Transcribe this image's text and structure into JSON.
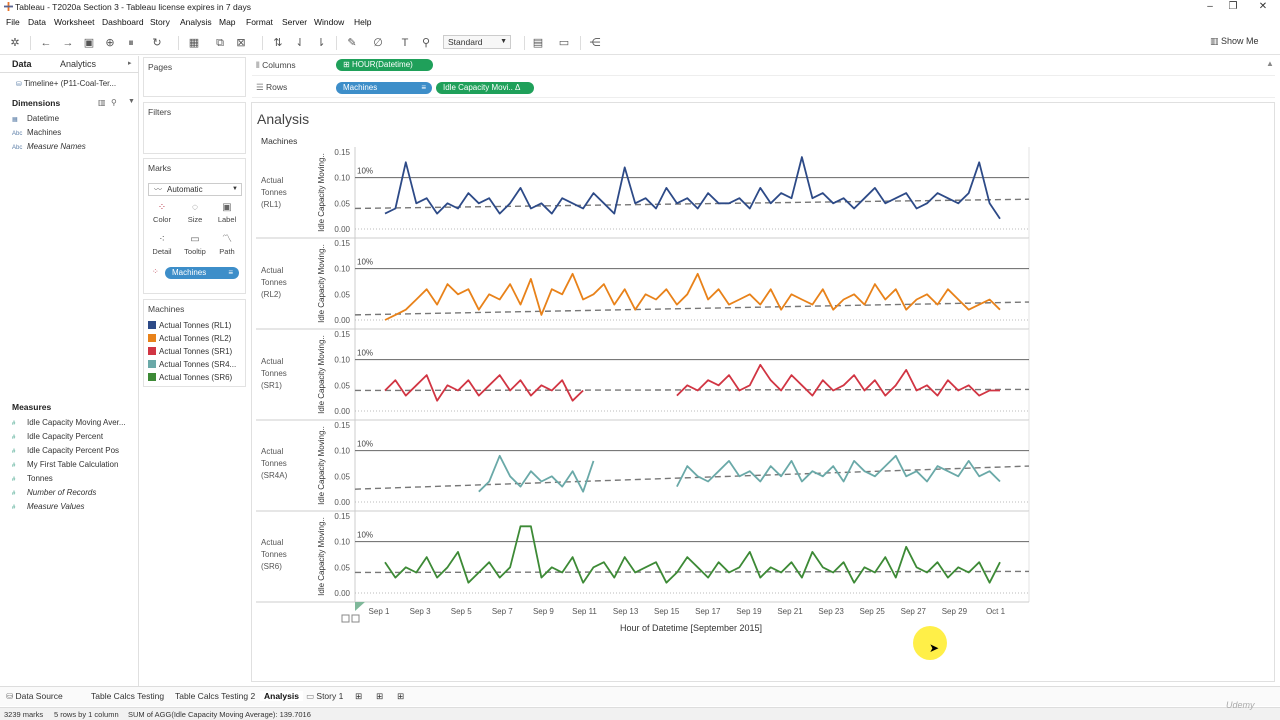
{
  "window": {
    "title": "Tableau - T2020a Section 3 - Tableau license expires in 7 days",
    "minimize": "–",
    "maximize": "❐",
    "close": "✕"
  },
  "menu": [
    "File",
    "Data",
    "Worksheet",
    "Dashboard",
    "Story",
    "Analysis",
    "Map",
    "Format",
    "Server",
    "Window",
    "Help"
  ],
  "toolbar": {
    "fit_select": "Standard",
    "show_me": "Show Me",
    "icons": [
      "tableau-logo-icon",
      "undo-icon",
      "redo-icon",
      "save-icon",
      "new-datasource-icon",
      "pause-icon",
      "refresh-icon",
      "new-worksheet-icon",
      "duplicate-icon",
      "clear-icon",
      "swap-icon",
      "sort-asc-icon",
      "sort-desc-icon",
      "highlight-icon",
      "group-icon",
      "label-icon",
      "pin-icon",
      "show-cards-icon",
      "presentation-icon",
      "share-icon"
    ]
  },
  "left_panel": {
    "tab_data": "Data",
    "tab_analytics": "Analytics",
    "datasource": "Timeline+ (P11-Coal-Ter...",
    "dimensions_title": "Dimensions",
    "dimensions": [
      {
        "icon": "date-icon",
        "label": "Datetime",
        "italic": false
      },
      {
        "icon": "abc-icon",
        "label": "Machines",
        "italic": false
      },
      {
        "icon": "abc-icon",
        "label": "Measure Names",
        "italic": true
      }
    ],
    "measures_title": "Measures",
    "measures": [
      {
        "label": "Idle Capacity Moving Aver...",
        "italic": false
      },
      {
        "label": "Idle Capacity Percent",
        "italic": false
      },
      {
        "label": "Idle Capacity Percent Pos",
        "italic": false
      },
      {
        "label": "My First Table Calculation",
        "italic": false
      },
      {
        "label": "Tonnes",
        "italic": false
      },
      {
        "label": "Number of Records",
        "italic": true
      },
      {
        "label": "Measure Values",
        "italic": true
      }
    ]
  },
  "cards": {
    "pages": "Pages",
    "filters": "Filters",
    "marks": "Marks",
    "marks_type": "Automatic",
    "mark_buttons": [
      {
        "label": "Color",
        "icon": "color-icon"
      },
      {
        "label": "Size",
        "icon": "size-icon"
      },
      {
        "label": "Label",
        "icon": "label-icon"
      },
      {
        "label": "Detail",
        "icon": "detail-icon"
      },
      {
        "label": "Tooltip",
        "icon": "tooltip-icon"
      },
      {
        "label": "Path",
        "icon": "path-icon"
      }
    ],
    "marks_pill": "Machines",
    "legend_title": "Machines",
    "legend": [
      {
        "label": "Actual Tonnes (RL1)",
        "color": "#2d4a87"
      },
      {
        "label": "Actual Tonnes (RL2)",
        "color": "#e8821a"
      },
      {
        "label": "Actual Tonnes (SR1)",
        "color": "#d13543"
      },
      {
        "label": "Actual Tonnes (SR4...",
        "color": "#6aa9a8"
      },
      {
        "label": "Actual Tonnes (SR6)",
        "color": "#3d8a36"
      }
    ]
  },
  "shelves": {
    "columns_label": "Columns",
    "rows_label": "Rows",
    "columns_pill": "HOUR(Datetime)",
    "rows_pill_1": "Machines",
    "rows_pill_2": "Idle Capacity Movi.. Δ"
  },
  "view": {
    "title": "Analysis",
    "row_header": "Machines",
    "y_axis_title": "Idle Capacity Moving..",
    "x_axis_title": "Hour of Datetime [September 2015]",
    "ref_label": "10%"
  },
  "chart_data": {
    "type": "line",
    "x_ticks": [
      "Sep 1",
      "Sep 3",
      "Sep 5",
      "Sep 7",
      "Sep 9",
      "Sep 11",
      "Sep 13",
      "Sep 15",
      "Sep 17",
      "Sep 19",
      "Sep 21",
      "Sep 23",
      "Sep 25",
      "Sep 27",
      "Sep 29",
      "Oct 1"
    ],
    "y_ticks": [
      "0.00",
      "0.05",
      "0.10",
      "0.15"
    ],
    "ylim": [
      0,
      0.15
    ],
    "reference_line": 0.1,
    "series": [
      {
        "name": "Actual Tonnes (RL1)",
        "color": "#2d4a87",
        "trend": [
          0.04,
          0.058
        ],
        "values": [
          0.03,
          0.04,
          0.13,
          0.05,
          0.06,
          0.03,
          0.05,
          0.04,
          0.07,
          0.05,
          0.06,
          0.03,
          0.05,
          0.08,
          0.04,
          0.05,
          0.03,
          0.06,
          0.05,
          0.04,
          0.07,
          0.05,
          0.03,
          0.12,
          0.05,
          0.06,
          0.04,
          0.08,
          0.05,
          0.06,
          0.04,
          0.07,
          0.05,
          0.05,
          0.06,
          0.04,
          0.08,
          0.05,
          0.07,
          0.06,
          0.14,
          0.06,
          0.07,
          0.05,
          0.06,
          0.04,
          0.06,
          0.08,
          0.05,
          0.06,
          0.07,
          0.04,
          0.05,
          0.07,
          0.06,
          0.05,
          0.07,
          0.13,
          0.05,
          0.02
        ]
      },
      {
        "name": "Actual Tonnes (RL2)",
        "color": "#e8821a",
        "trend": [
          0.01,
          0.035
        ],
        "values": [
          0.0,
          0.01,
          0.02,
          0.04,
          0.06,
          0.03,
          0.07,
          0.05,
          0.06,
          0.02,
          0.05,
          0.04,
          0.07,
          0.03,
          0.08,
          0.01,
          0.06,
          0.05,
          0.09,
          0.04,
          0.05,
          0.07,
          0.03,
          0.06,
          0.02,
          0.05,
          0.04,
          0.06,
          0.03,
          0.05,
          0.09,
          0.04,
          0.06,
          0.03,
          0.04,
          0.05,
          0.03,
          0.06,
          0.02,
          0.05,
          0.04,
          0.03,
          0.06,
          0.02,
          0.04,
          0.05,
          0.03,
          0.07,
          0.04,
          0.06,
          0.02,
          0.04,
          0.05,
          0.03,
          0.06,
          0.04,
          0.02,
          0.03,
          0.04,
          0.02
        ]
      },
      {
        "name": "Actual Tonnes (SR1)",
        "color": "#d13543",
        "trend": [
          0.04,
          0.042
        ],
        "values": [
          0.04,
          0.06,
          0.03,
          0.05,
          0.07,
          0.02,
          0.05,
          0.04,
          0.06,
          0.03,
          0.05,
          0.07,
          0.04,
          0.06,
          0.03,
          0.05,
          0.04,
          0.06,
          0.02,
          0.04,
          null,
          null,
          null,
          null,
          null,
          null,
          null,
          null,
          0.03,
          0.05,
          0.04,
          0.06,
          0.05,
          0.07,
          0.04,
          0.05,
          0.09,
          0.06,
          0.04,
          0.07,
          0.05,
          0.03,
          0.06,
          0.04,
          0.05,
          0.07,
          0.04,
          0.06,
          0.03,
          0.05,
          0.08,
          0.04,
          0.05,
          0.03,
          0.06,
          0.04,
          0.05,
          0.03,
          0.04,
          0.04
        ]
      },
      {
        "name": "Actual Tonnes (SR4A)",
        "color": "#6aa9a8",
        "trend": [
          0.025,
          0.07
        ],
        "values": [
          null,
          null,
          null,
          null,
          null,
          null,
          null,
          null,
          null,
          0.02,
          0.04,
          0.09,
          0.05,
          0.03,
          0.06,
          0.04,
          0.05,
          0.03,
          0.06,
          0.02,
          0.08,
          null,
          null,
          null,
          null,
          null,
          null,
          null,
          0.03,
          0.07,
          0.05,
          0.04,
          0.06,
          0.08,
          0.05,
          0.06,
          0.04,
          0.07,
          0.05,
          0.08,
          0.04,
          0.06,
          0.05,
          0.07,
          0.04,
          0.08,
          0.06,
          0.05,
          0.07,
          0.09,
          0.05,
          0.06,
          0.04,
          0.07,
          0.06,
          0.05,
          0.08,
          0.05,
          0.06,
          0.04
        ]
      },
      {
        "name": "Actual Tonnes (SR6)",
        "color": "#3d8a36",
        "trend": [
          0.04,
          0.042
        ],
        "values": [
          0.06,
          0.03,
          0.05,
          0.04,
          0.07,
          0.03,
          0.05,
          0.08,
          0.02,
          0.04,
          0.06,
          0.03,
          0.05,
          0.13,
          0.13,
          0.03,
          0.05,
          0.04,
          0.07,
          0.02,
          0.05,
          0.06,
          0.03,
          0.07,
          0.04,
          0.05,
          0.06,
          0.02,
          0.04,
          0.07,
          0.05,
          0.03,
          0.06,
          0.04,
          0.05,
          0.08,
          0.03,
          0.05,
          0.04,
          0.06,
          0.03,
          0.08,
          0.05,
          0.04,
          0.06,
          0.02,
          0.05,
          0.04,
          0.07,
          0.03,
          0.09,
          0.05,
          0.04,
          0.06,
          0.03,
          0.05,
          0.04,
          0.06,
          0.02,
          0.06
        ]
      }
    ]
  },
  "sheet_tabs": [
    {
      "label": "Data Source",
      "active": false
    },
    {
      "label": "Table Calcs Testing",
      "active": false
    },
    {
      "label": "Table Calcs Testing 2",
      "active": false
    },
    {
      "label": "Analysis",
      "active": true
    },
    {
      "label": "Story 1",
      "active": false
    }
  ],
  "status": {
    "marks": "3239 marks",
    "rows": "5 rows by 1 column",
    "sum": "SUM of AGG(Idle Capacity Moving Average): 139.7016"
  },
  "watermark": "Udemy"
}
